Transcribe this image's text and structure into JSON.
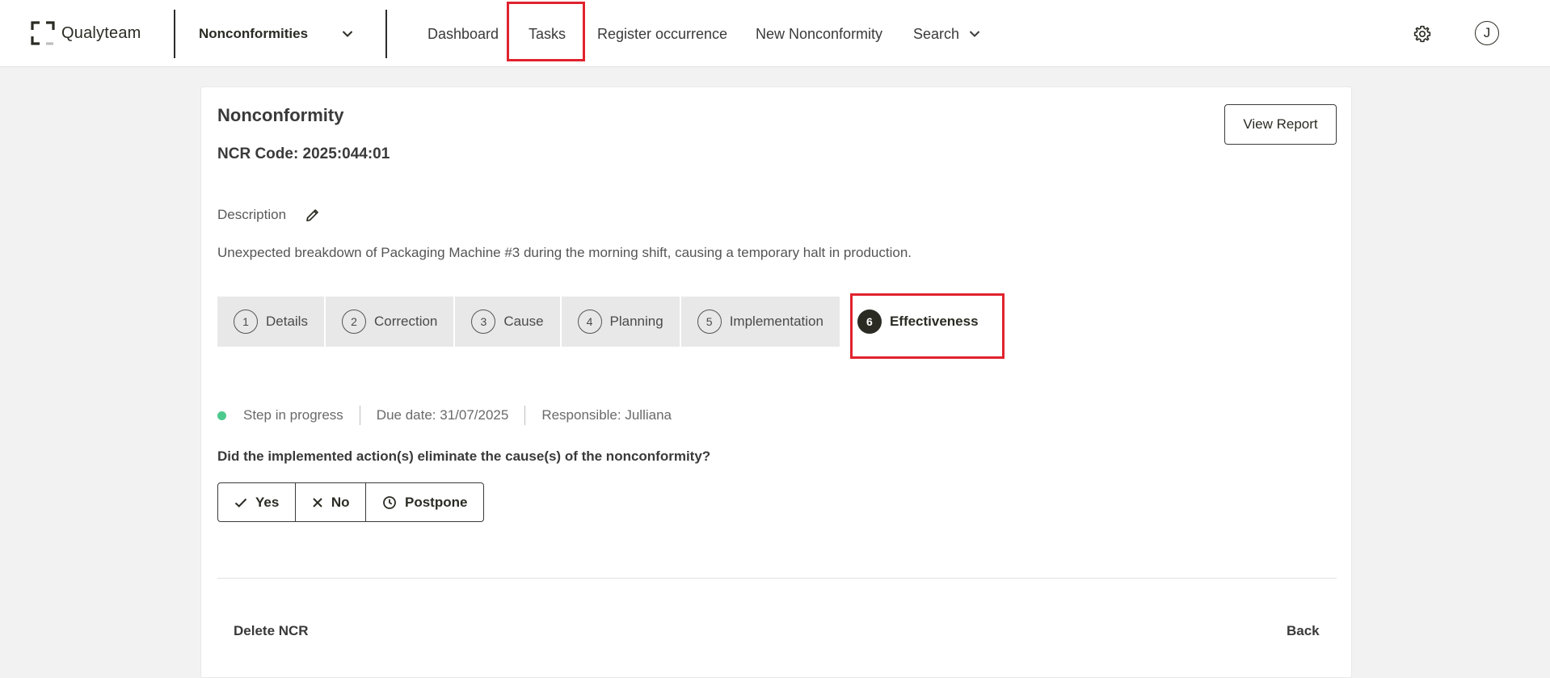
{
  "header": {
    "logo_text": "Qualyteam",
    "module": "Nonconformities",
    "nav": {
      "dashboard": "Dashboard",
      "tasks": "Tasks",
      "register": "Register occurrence",
      "new_nc": "New Nonconformity",
      "search": "Search"
    },
    "avatar_initial": "J"
  },
  "page": {
    "title": "Nonconformity",
    "ncr_code": "NCR Code: 2025:044:01",
    "view_report": "View Report",
    "description_label": "Description",
    "description_text": "Unexpected breakdown of Packaging Machine #3 during the morning shift, causing a temporary halt in production."
  },
  "steps": [
    {
      "num": "1",
      "label": "Details"
    },
    {
      "num": "2",
      "label": "Correction"
    },
    {
      "num": "3",
      "label": "Cause"
    },
    {
      "num": "4",
      "label": "Planning"
    },
    {
      "num": "5",
      "label": "Implementation"
    },
    {
      "num": "6",
      "label": "Effectiveness"
    }
  ],
  "status": {
    "state": "Step in progress",
    "due": "Due date: 31/07/2025",
    "responsible": "Responsible: Julliana",
    "color": "#4cc98c"
  },
  "question": "Did the implemented action(s) eliminate the cause(s) of the nonconformity?",
  "choices": {
    "yes": "Yes",
    "no": "No",
    "postpone": "Postpone"
  },
  "footer": {
    "delete": "Delete NCR",
    "back": "Back"
  },
  "colors": {
    "highlight": "#e0232e",
    "dark": "#2b2b24"
  }
}
